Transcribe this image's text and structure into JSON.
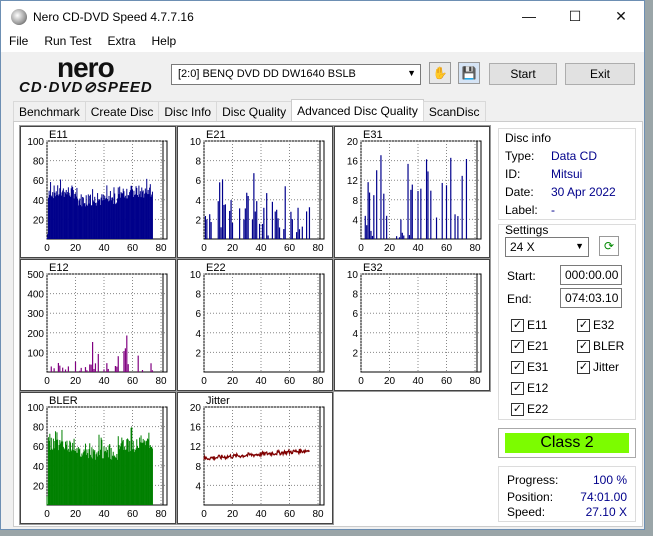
{
  "window": {
    "title": "Nero CD-DVD Speed 4.7.7.16",
    "min": "—",
    "max": "☐",
    "close": "✕"
  },
  "menu": [
    "File",
    "Run Test",
    "Extra",
    "Help"
  ],
  "logo": {
    "top": "nero",
    "bottom": "CD·DVD⊘SPEED"
  },
  "drive": {
    "label": "[2:0]  BENQ DVD DD DW1640 BSLB"
  },
  "buttons": {
    "start": "Start",
    "exit": "Exit"
  },
  "tabs": [
    "Benchmark",
    "Create Disc",
    "Disc Info",
    "Disc Quality",
    "Advanced Disc Quality",
    "ScanDisc"
  ],
  "disc_info": {
    "title": "Disc info",
    "type_label": "Type:",
    "type": "Data CD",
    "id_label": "ID:",
    "id": "Mitsui",
    "date_label": "Date:",
    "date": "30 Apr 2022",
    "label_label": "Label:",
    "label": "-"
  },
  "settings": {
    "title": "Settings",
    "speed": "24 X",
    "start_label": "Start:",
    "start": "000:00.00",
    "end_label": "End:",
    "end": "074:03.10",
    "checks": [
      "E11",
      "E32",
      "E21",
      "BLER",
      "E31",
      "Jitter",
      "E12",
      "E22"
    ]
  },
  "class": "Class 2",
  "progress": {
    "progress_label": "Progress:",
    "progress": "100 %",
    "position_label": "Position:",
    "position": "74:01.00",
    "speed_label": "Speed:",
    "speed": "27.10 X"
  },
  "chart_data": [
    {
      "type": "bar",
      "title": "E11",
      "ylim": [
        0,
        100
      ],
      "yticks": [
        20,
        40,
        60,
        80,
        100
      ],
      "xticks": [
        0,
        20,
        40,
        60,
        80
      ],
      "color": "#00008b",
      "profile": "e11"
    },
    {
      "type": "bar",
      "title": "E21",
      "ylim": [
        0,
        10
      ],
      "yticks": [
        2,
        4,
        6,
        8,
        10
      ],
      "xticks": [
        0,
        20,
        40,
        60,
        80
      ],
      "color": "#00008b",
      "profile": "e21"
    },
    {
      "type": "bar",
      "title": "E31",
      "ylim": [
        0,
        20
      ],
      "yticks": [
        4,
        8,
        12,
        16,
        20
      ],
      "xticks": [
        0,
        20,
        40,
        60,
        80
      ],
      "color": "#00008b",
      "profile": "e31"
    },
    {
      "type": "bar",
      "title": "E12",
      "ylim": [
        0,
        500
      ],
      "yticks": [
        100,
        200,
        300,
        400,
        500
      ],
      "xticks": [
        0,
        20,
        40,
        60,
        80
      ],
      "color": "#800080",
      "profile": "e12"
    },
    {
      "type": "bar",
      "title": "E22",
      "ylim": [
        0,
        10
      ],
      "yticks": [
        2,
        4,
        6,
        8,
        10
      ],
      "xticks": [
        0,
        20,
        40,
        60,
        80
      ],
      "color": "#800080",
      "profile": "empty"
    },
    {
      "type": "bar",
      "title": "E32",
      "ylim": [
        0,
        10
      ],
      "yticks": [
        2,
        4,
        6,
        8,
        10
      ],
      "xticks": [
        0,
        20,
        40,
        60,
        80
      ],
      "color": "#800080",
      "profile": "empty"
    },
    {
      "type": "bar",
      "title": "BLER",
      "ylim": [
        0,
        100
      ],
      "yticks": [
        20,
        40,
        60,
        80,
        100
      ],
      "xticks": [
        0,
        20,
        40,
        60,
        80
      ],
      "color": "#008000",
      "profile": "bler"
    },
    {
      "type": "line",
      "title": "Jitter",
      "ylim": [
        0,
        20
      ],
      "yticks": [
        4,
        8,
        12,
        16,
        20
      ],
      "xticks": [
        0,
        20,
        40,
        60,
        80
      ],
      "color": "#800000",
      "profile": "jitter"
    }
  ]
}
